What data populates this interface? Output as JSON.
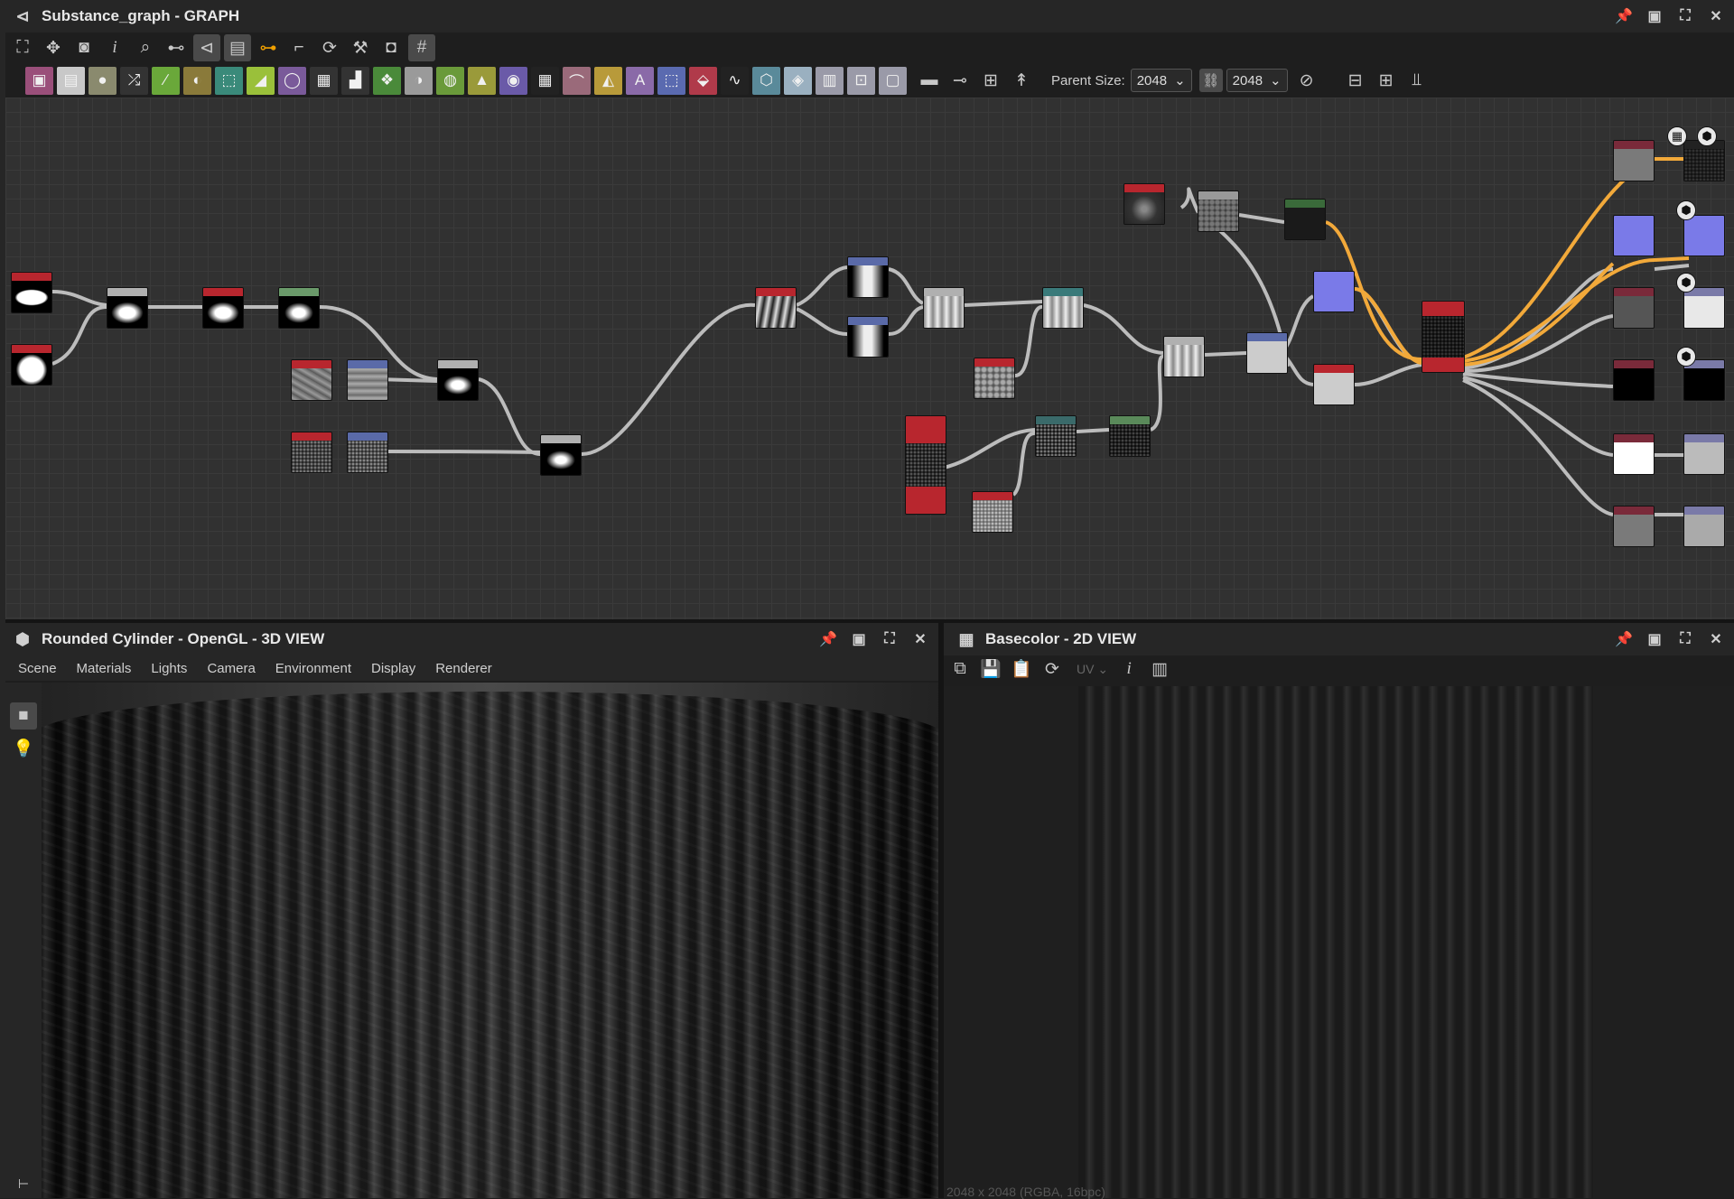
{
  "graph_panel": {
    "title": "Substance_graph - GRAPH",
    "toolbar_icons": [
      "frame-all-icon",
      "pan-icon",
      "screenshot-icon",
      "info-icon",
      "search-icon",
      "align-icon",
      "graph-icon",
      "layout-icon",
      "link-icon",
      "connector-icon",
      "refresh-icon",
      "tools-icon",
      "snapshot-icon",
      "grid-icon"
    ],
    "library_buttons": [
      {
        "name": "bitmap-node",
        "color": "#9a4f7a",
        "glyph": "▣"
      },
      {
        "name": "svg-node",
        "color": "#c8c8c8",
        "glyph": "▤"
      },
      {
        "name": "uniform-color-node",
        "color": "#8a8a6e",
        "glyph": "●"
      },
      {
        "name": "switch-node",
        "color": "#333333",
        "glyph": "⤮"
      },
      {
        "name": "curve-node",
        "color": "#6aa83a",
        "glyph": "∕"
      },
      {
        "name": "levels-node",
        "color": "#8a7a3a",
        "glyph": "◐"
      },
      {
        "name": "transform-node",
        "color": "#3a8a7a",
        "glyph": "⬚"
      },
      {
        "name": "gradient-node",
        "color": "#9ac03a",
        "glyph": "◢"
      },
      {
        "name": "blur-node",
        "color": "#7a5a9a",
        "glyph": "◯"
      },
      {
        "name": "tile-node",
        "color": "#333333",
        "glyph": "▦"
      },
      {
        "name": "normal-node",
        "color": "#333333",
        "glyph": "▟"
      },
      {
        "name": "warp-node",
        "color": "#4a8a3a",
        "glyph": "❖"
      },
      {
        "name": "blend-node",
        "color": "#9a9a9a",
        "glyph": "◑"
      },
      {
        "name": "grayscale-node",
        "color": "#6a9a3a",
        "glyph": "◍"
      },
      {
        "name": "histogram-node",
        "color": "#9a9a3a",
        "glyph": "▲"
      },
      {
        "name": "hsl-node",
        "color": "#6a5aa8",
        "glyph": "◉"
      },
      {
        "name": "fxmap-node",
        "color": "#222222",
        "glyph": "▦"
      },
      {
        "name": "pixel-processor-node",
        "color": "#9a6a7a",
        "glyph": "⌒"
      },
      {
        "name": "mirror-node",
        "color": "#b89a3a",
        "glyph": "◭"
      },
      {
        "name": "text-node",
        "color": "#8a6aa8",
        "glyph": "A"
      },
      {
        "name": "crop-node",
        "color": "#5a6ab0",
        "glyph": "⬚"
      },
      {
        "name": "fill-node",
        "color": "#b03a4a",
        "glyph": "⬙"
      },
      {
        "name": "value-node",
        "color": "#222222",
        "glyph": "∿"
      },
      {
        "name": "distance-node",
        "color": "#5a8a9a",
        "glyph": "⬡"
      },
      {
        "name": "shape-node",
        "color": "#9ab0c0",
        "glyph": "◈"
      },
      {
        "name": "emboss-node",
        "color": "#9a9aa8",
        "glyph": "▥"
      },
      {
        "name": "gradient-map-node",
        "color": "#9a9aa8",
        "glyph": "⊡"
      },
      {
        "name": "output-node",
        "color": "#9a9aa8",
        "glyph": "▢"
      }
    ],
    "extra_tools": [
      "comment-icon",
      "pin-icon",
      "frame-icon",
      "arrow-icon"
    ],
    "parent_size": {
      "label": "Parent Size:",
      "value_a": "2048",
      "value_b": "2048"
    },
    "right_tools": [
      "align-h-icon",
      "align-v-icon",
      "snap-icon"
    ]
  },
  "view3d": {
    "title": "Rounded Cylinder - OpenGL - 3D VIEW",
    "menu": [
      "Scene",
      "Materials",
      "Lights",
      "Camera",
      "Environment",
      "Display",
      "Renderer"
    ]
  },
  "view2d": {
    "title": "Basecolor - 2D VIEW",
    "uv_label": "UV",
    "texture_info": "2048 x 2048 (RGBA, 16bpc)"
  }
}
